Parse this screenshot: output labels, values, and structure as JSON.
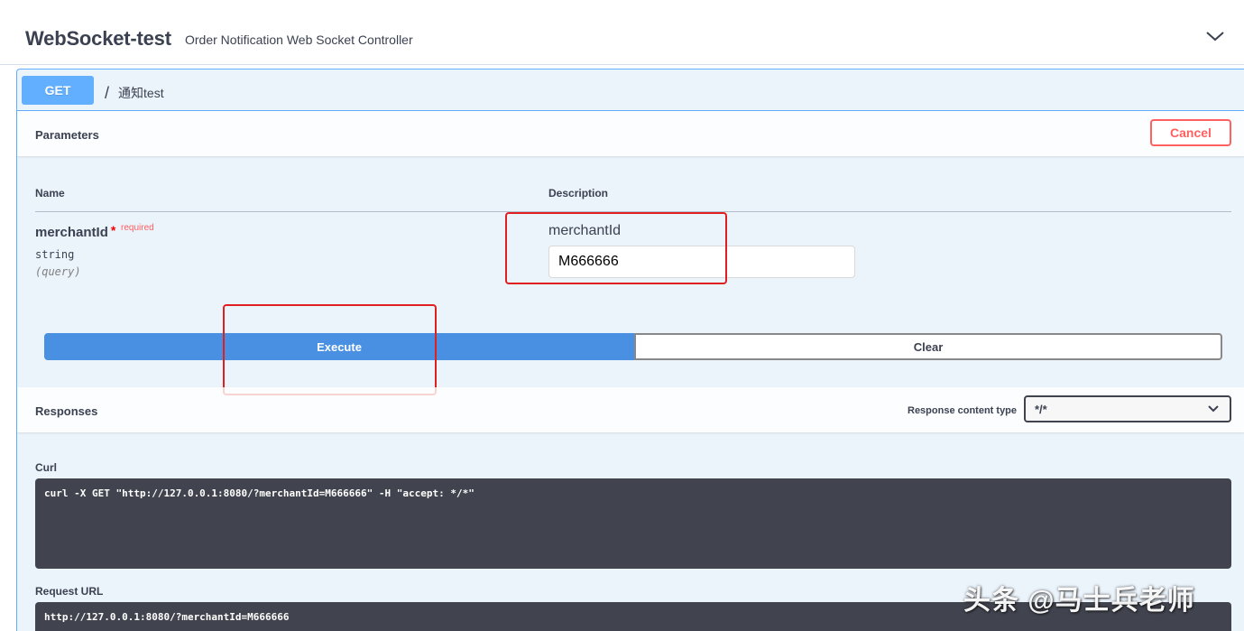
{
  "tag": {
    "name": "WebSocket-test",
    "description": "Order Notification Web Socket Controller"
  },
  "operation": {
    "method": "GET",
    "slash": "/",
    "path": "通知test"
  },
  "parameters": {
    "title": "Parameters",
    "cancel_label": "Cancel",
    "col_name": "Name",
    "col_description": "Description",
    "items": [
      {
        "name": "merchantId",
        "required_star": "*",
        "required_label": "required",
        "type": "string",
        "in": "(query)",
        "description": "merchantId",
        "value": "M666666"
      }
    ]
  },
  "actions": {
    "execute_label": "Execute",
    "clear_label": "Clear"
  },
  "responses": {
    "title": "Responses",
    "content_type_label": "Response content type",
    "content_type_value": "*/*",
    "curl_label": "Curl",
    "curl": "curl -X GET \"http://127.0.0.1:8080/?merchantId=M666666\" -H \"accept: */*\"",
    "request_url_label": "Request URL",
    "request_url": "http://127.0.0.1:8080/?merchantId=M666666"
  },
  "watermark": "头条 @马士兵老师",
  "colors": {
    "get": "#61affe",
    "execute": "#4990e2",
    "cancel": "#ff6060",
    "code_bg": "#41444e",
    "annotation": "#e02020"
  },
  "icons": {
    "tag_toggle": "chevron-down-icon",
    "select_toggle": "chevron-down-icon"
  }
}
